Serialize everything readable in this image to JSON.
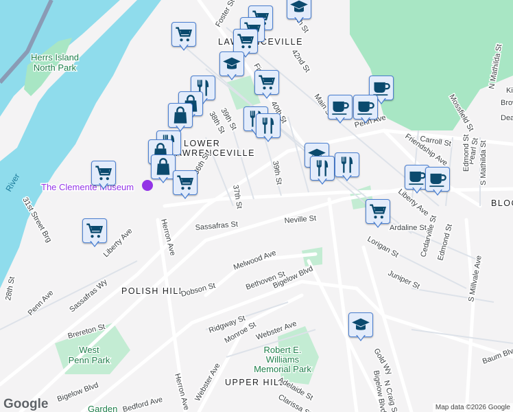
{
  "map": {
    "water_label": "River",
    "parks": [
      "Herrs Island\nNorth Park",
      "West\nPenn Park",
      "Robert E.\nWilliams\nMemorial Park",
      "Garden"
    ],
    "neighborhoods": [
      "LAWRENCEVILLE",
      "LOWER\nLAWRENCEVILLE",
      "POLISH HILL",
      "UPPER HILL",
      "BLOOMFIELD"
    ],
    "poi": "The Clemente Museum",
    "streets": [
      "Foster St",
      "Fisk St",
      "42nd St",
      "44th St",
      "40th St",
      "39th St",
      "38th St",
      "37th St",
      "36th St",
      "39th St",
      "Main St",
      "Penn Ave",
      "Carroll St",
      "Friendship Ave",
      "Pearl St",
      "Edmond St",
      "S Mathilda St",
      "N Mathilda St",
      "Mossfield St",
      "Liberty Ave",
      "Sassafras St",
      "Neville St",
      "Herron Ave",
      "Melwood Ave",
      "Bethoven St",
      "Dobson St",
      "Bigelow Blvd",
      "Ridgway St",
      "Monroe St",
      "Webster Ave",
      "Brereton St",
      "28th St",
      "Penn Ave",
      "Liberty Ave",
      "31st Street Brg",
      "Sassafras Wy",
      "Lorigan St",
      "Juniper St",
      "Cedarville St",
      "Edmond St",
      "S Millvale Ave",
      "Baum Blvd",
      "Gold Wy",
      "N Craig St",
      "Adelaide St",
      "Clarissa St",
      "Bedford Ave",
      "Webster Ave",
      "Herron Ave",
      "Bigelow Blvd",
      "Bigelow Blvd",
      "Kirkpatrick St",
      "Brown St",
      "Dearborn St",
      "Ardaline St"
    ],
    "shield": "28"
  },
  "markers": {
    "cart": "shopping-cart",
    "grad": "school",
    "cafe": "cafe",
    "fork": "restaurant",
    "bag": "shopping-bag"
  },
  "footer": {
    "logo": "Google",
    "attribution": "Map data ©2026 Google"
  },
  "colors": {
    "water": "#8fdcec",
    "park": "#a8e6c4",
    "road": "#d5dbe3",
    "marker_bg": "#e3ecfb",
    "marker_border": "#4a7fd1",
    "icon": "#0b4a6e"
  }
}
